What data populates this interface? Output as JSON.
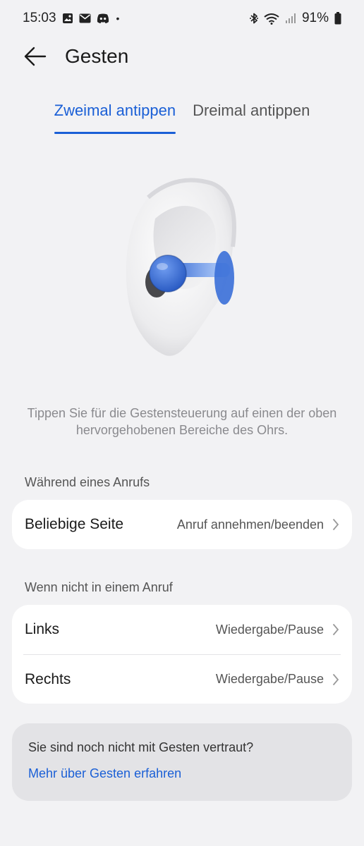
{
  "status_bar": {
    "time": "15:03",
    "left_icons": [
      "image-icon",
      "mail-icon",
      "discord-icon"
    ],
    "dot": "•",
    "battery": "91%",
    "right_icons": [
      "bluetooth-icon",
      "wifi-icon",
      "signal-icon",
      "battery-icon"
    ]
  },
  "header": {
    "title": "Gesten",
    "back_icon": "arrow-left-icon"
  },
  "tabs": [
    {
      "label": "Zweimal antippen",
      "active": true
    },
    {
      "label": "Dreimal antippen",
      "active": false
    }
  ],
  "illustration": {
    "name": "ear-with-earbud",
    "accent_color": "#3a73d6"
  },
  "description": "Tippen Sie für die Gestensteuerung auf einen der oben hervorgehobenen Bereiche des Ohrs.",
  "sections": [
    {
      "label": "Während eines Anrufs",
      "rows": [
        {
          "label": "Beliebige Seite",
          "value": "Anruf annehmen/beenden"
        }
      ]
    },
    {
      "label": "Wenn nicht in einem Anruf",
      "rows": [
        {
          "label": "Links",
          "value": "Wiedergabe/Pause"
        },
        {
          "label": "Rechts",
          "value": "Wiedergabe/Pause"
        }
      ]
    }
  ],
  "info": {
    "text": "Sie sind noch nicht mit Gesten vertraut?",
    "link": "Mehr über Gesten erfahren"
  },
  "colors": {
    "accent": "#1a5fd6",
    "background": "#f2f2f4",
    "card": "#ffffff"
  }
}
